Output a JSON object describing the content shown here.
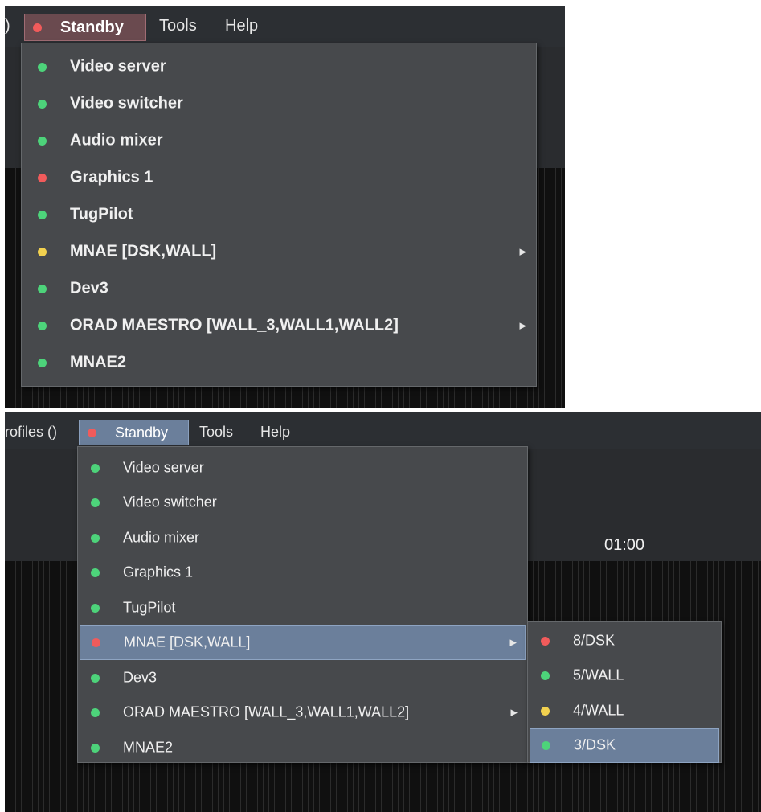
{
  "top_panel": {
    "menubar": {
      "partial_text": ")",
      "standby_label": "Standby",
      "tools_label": "Tools",
      "help_label": "Help"
    },
    "items": [
      {
        "label": "Video server",
        "status": "green"
      },
      {
        "label": "Video switcher",
        "status": "green"
      },
      {
        "label": "Audio mixer",
        "status": "green"
      },
      {
        "label": "Graphics 1",
        "status": "red"
      },
      {
        "label": "TugPilot",
        "status": "green"
      },
      {
        "label": "MNAE [DSK,WALL]",
        "status": "yellow",
        "submenu": true
      },
      {
        "label": "Dev3",
        "status": "green"
      },
      {
        "label": "ORAD MAESTRO [WALL_3,WALL1,WALL2]",
        "status": "green",
        "submenu": true
      },
      {
        "label": "MNAE2",
        "status": "green"
      }
    ]
  },
  "bottom_panel": {
    "menubar": {
      "profiles_label": "rofiles ()",
      "standby_label": "Standby",
      "tools_label": "Tools",
      "help_label": "Help"
    },
    "time_label": "01:00",
    "items": [
      {
        "label": "Video server",
        "status": "green"
      },
      {
        "label": "Video switcher",
        "status": "green"
      },
      {
        "label": "Audio mixer",
        "status": "green"
      },
      {
        "label": "Graphics 1",
        "status": "green"
      },
      {
        "label": "TugPilot",
        "status": "green"
      },
      {
        "label": "MNAE [DSK,WALL]",
        "status": "red",
        "submenu": true,
        "highlighted": true
      },
      {
        "label": "Dev3",
        "status": "green"
      },
      {
        "label": "ORAD MAESTRO [WALL_3,WALL1,WALL2]",
        "status": "green",
        "submenu": true
      },
      {
        "label": "MNAE2",
        "status": "green"
      }
    ],
    "submenu_items": [
      {
        "label": "8/DSK",
        "status": "red"
      },
      {
        "label": "5/WALL",
        "status": "green"
      },
      {
        "label": "4/WALL",
        "status": "yellow"
      },
      {
        "label": "3/DSK",
        "status": "green",
        "highlighted": true
      }
    ]
  },
  "colors": {
    "red": "#f15b5b",
    "green": "#4dd37a",
    "yellow": "#f2d14f",
    "highlight": "#6b7f9b",
    "menu_bg": "#47494c"
  },
  "icons": {
    "status_dot": "status-dot-icon",
    "submenu_arrow": "submenu-arrow-icon"
  }
}
